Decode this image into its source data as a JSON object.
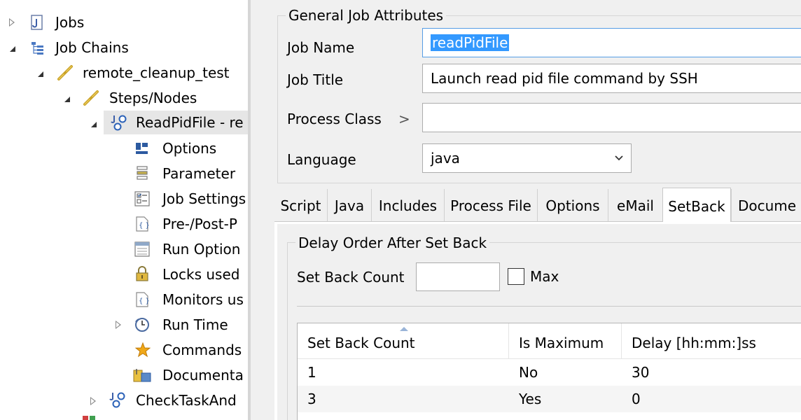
{
  "tree": {
    "items": [
      {
        "label": "Jobs",
        "icon": "jobs-folder-icon"
      },
      {
        "label": "Job Chains",
        "icon": "job-chains-icon"
      },
      {
        "label": "remote_cleanup_test",
        "icon": "chain-icon"
      },
      {
        "label": "Steps/Nodes",
        "icon": "chain-icon"
      },
      {
        "label": "ReadPidFile - re",
        "icon": "job-node-icon"
      },
      {
        "label": "Options",
        "icon": "options-icon"
      },
      {
        "label": "Parameter",
        "icon": "parameter-icon"
      },
      {
        "label": "Job Settings",
        "icon": "job-settings-icon"
      },
      {
        "label": "Pre-/Post-P",
        "icon": "pre-post-icon"
      },
      {
        "label": "Run Option",
        "icon": "run-options-icon"
      },
      {
        "label": "Locks used",
        "icon": "lock-icon"
      },
      {
        "label": "Monitors us",
        "icon": "monitor-icon"
      },
      {
        "label": "Run Time",
        "icon": "clock-icon"
      },
      {
        "label": "Commands",
        "icon": "star-icon"
      },
      {
        "label": "Documenta",
        "icon": "documentation-icon"
      },
      {
        "label": "CheckTaskAnd",
        "icon": "job-node-icon"
      }
    ]
  },
  "general": {
    "legend": "General Job Attributes",
    "job_name_label": "Job Name",
    "job_name_value": "readPidFile",
    "job_title_label": "Job Title",
    "job_title_value": "Launch read pid file command by SSH",
    "process_class_label": "Process Class",
    "process_class_chevron": ">",
    "process_class_value": "",
    "language_label": "Language",
    "language_value": "java"
  },
  "tabs": [
    {
      "label": "Script"
    },
    {
      "label": "Java"
    },
    {
      "label": "Includes"
    },
    {
      "label": "Process File"
    },
    {
      "label": "Options"
    },
    {
      "label": "eMail"
    },
    {
      "label": "SetBack",
      "active": true
    },
    {
      "label": "Docume"
    }
  ],
  "setback": {
    "legend": "Delay Order After Set Back",
    "count_label": "Set Back Count",
    "count_value": "",
    "max_label": "Max",
    "max_checked": false
  },
  "table": {
    "columns": [
      "Set Back Count",
      "Is Maximum",
      "Delay [hh:mm:]ss"
    ],
    "rows": [
      [
        "1",
        "No",
        "30"
      ],
      [
        "3",
        "Yes",
        "0"
      ]
    ]
  },
  "colors": {
    "selection": "#3399ff",
    "focus_border": "#569de5",
    "panel_bg": "#f0f0f0"
  }
}
